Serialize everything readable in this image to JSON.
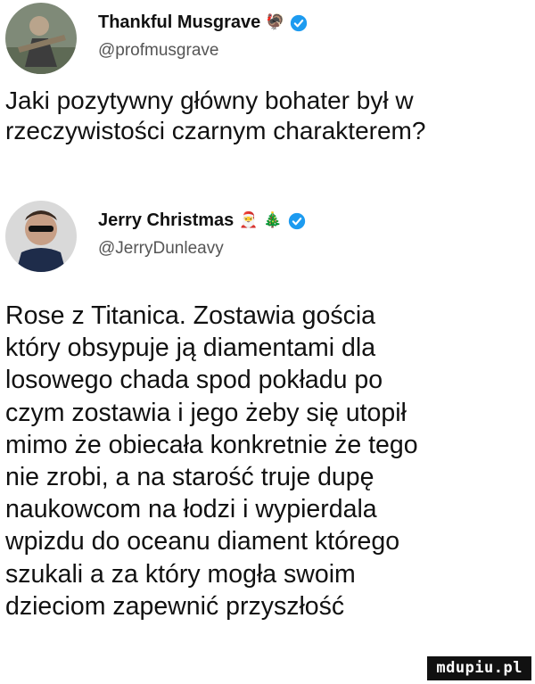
{
  "tweet1": {
    "display_name": "Thankful Musgrave",
    "name_emoji": "🦃",
    "handle": "@profmusgrave",
    "text": "Jaki pozytywny główny bohater był w\nrzeczywistości czarnym charakterem?"
  },
  "tweet2": {
    "display_name": "Jerry Christmas",
    "name_emoji": "🎅 🎄",
    "handle": "@JerryDunleavy",
    "text": "Rose z Titanica. Zostawia gościa\nktóry obsypuje ją diamentami dla\nlosowego chada spod pokładu po\nczym zostawia i jego żeby się utopił\nmimo że obiecała konkretnie że tego\nnie zrobi, a na starość truje dupę\nnaukowcom na łodzi i wypierdala\nwpizdu do oceanu diament którego\nszukali a za który mogła swoim\ndzieciom zapewnić przyszłość"
  },
  "watermark": "mdupiu.pl",
  "colors": {
    "verified": "#1d9bf0",
    "text": "#111111",
    "handle": "#555555"
  },
  "icons": {
    "verified": "verified-badge-icon"
  }
}
